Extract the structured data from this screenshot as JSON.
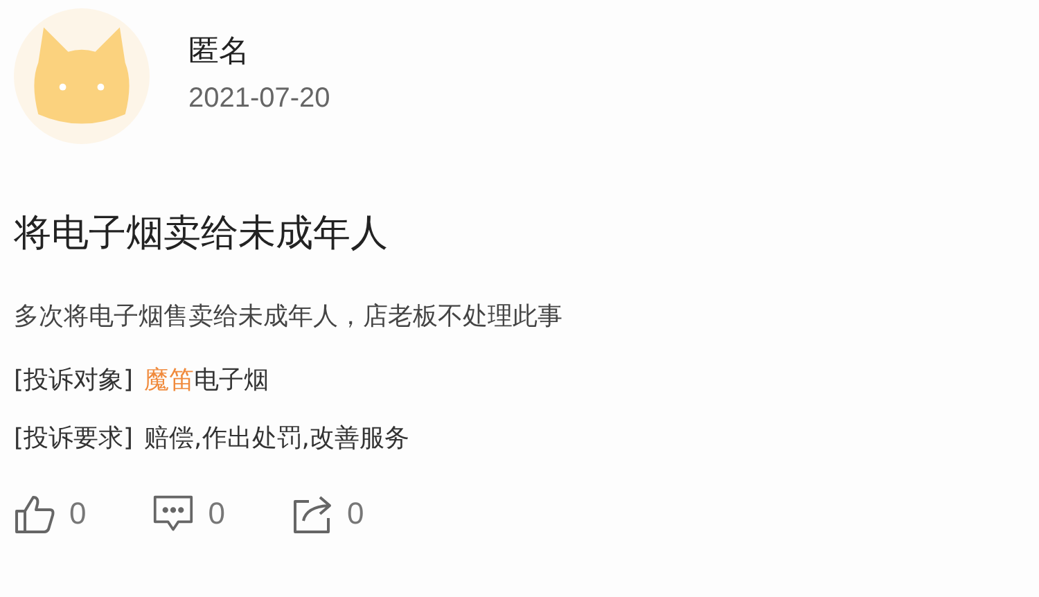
{
  "author": {
    "name": "匿名",
    "date": "2021-07-20"
  },
  "title": "将电子烟卖给未成年人",
  "description": "多次将电子烟售卖给未成年人，店老板不处理此事",
  "fields": [
    {
      "label": "[投诉对象]",
      "link": "魔笛",
      "value": "电子烟"
    },
    {
      "label": "[投诉要求]",
      "value": "赔偿,作出处罚,改善服务"
    }
  ],
  "actions": [
    {
      "kind": "like",
      "count": "0"
    },
    {
      "kind": "comment",
      "count": "0"
    },
    {
      "kind": "share",
      "count": "0"
    }
  ]
}
